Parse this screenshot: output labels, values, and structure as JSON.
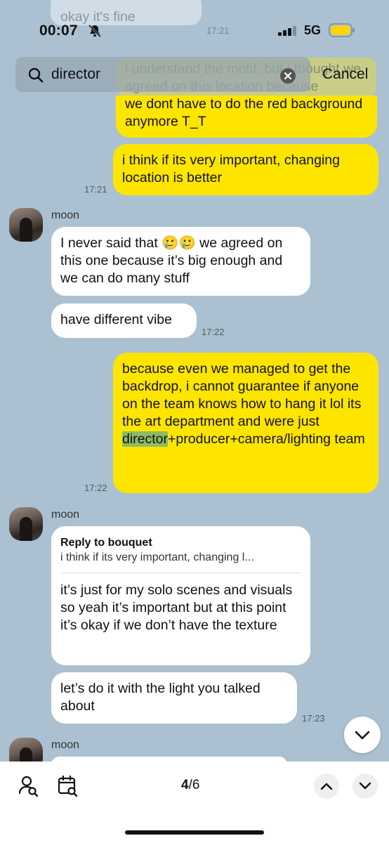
{
  "status": {
    "time": "00:07",
    "network": "5G"
  },
  "search": {
    "query": "director",
    "cancel_label": "Cancel"
  },
  "ghost_messages": {
    "top_partial": "okay it's fine",
    "top_time": "17:21",
    "behind_search": "i understand the motif, but i thought we agreed on this location because"
  },
  "messages": [
    {
      "from": "me",
      "text": "we dont have to do the red background anymore T_T"
    },
    {
      "from": "me",
      "text": "i think if its very important, changing location is better",
      "time": "17:21"
    },
    {
      "from": "them",
      "sender": "moon",
      "text": "I never said that 🥲🥲 we agreed on this one because it’s big enough and we can do many stuff"
    },
    {
      "from": "them",
      "text": "have different vibe",
      "time": "17:22"
    },
    {
      "from": "me",
      "text_before": "because even we managed to get the backdrop, i cannot guarantee if anyone on the team knows how to hang it lol its the art department and were just ",
      "highlight": "director",
      "text_after": "+producer+camera/lighting team",
      "time": "17:22"
    },
    {
      "from": "them",
      "sender": "moon",
      "reply_to": "Reply to bouquet",
      "reply_preview": "i think if its very important, changing l...",
      "text": "it’s just for my solo scenes and visuals so yeah it’s important but at this point it’s okay if we don’t have the texture"
    },
    {
      "from": "them",
      "text": "let’s do it with the light you talked about",
      "time": "17:23"
    },
    {
      "from": "them",
      "sender": "moon"
    }
  ],
  "bottom_bar": {
    "current_match": "4",
    "total_matches": "/6"
  },
  "colors": {
    "background": "#abc1d1",
    "my_bubble": "#fee500",
    "their_bubble": "#ffffff",
    "highlight": "#8fbb64"
  },
  "icons": [
    "bell-slash-icon",
    "signal-icon",
    "battery-icon",
    "search-icon",
    "clear-icon",
    "chevron-down-icon",
    "person-search-icon",
    "calendar-search-icon",
    "chevron-up-icon"
  ]
}
